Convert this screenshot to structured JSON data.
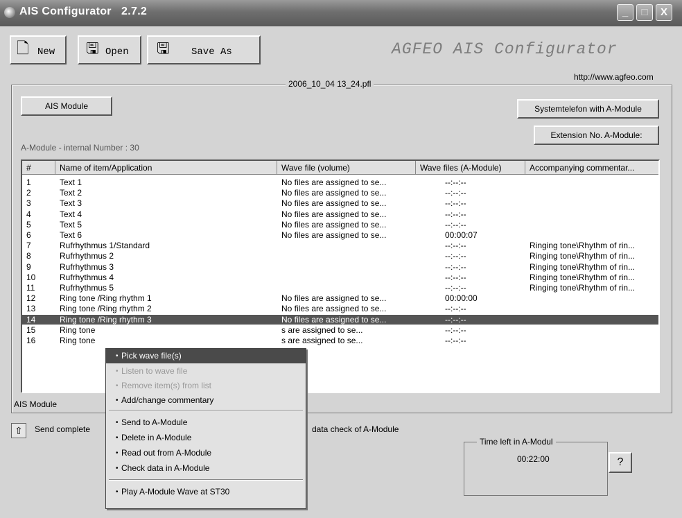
{
  "window": {
    "title": "AIS Configurator",
    "version": "2.7.2",
    "minimize": "_",
    "maximize": "□",
    "close": "X"
  },
  "toolbar": {
    "new_label": "New",
    "open_label": "Open",
    "saveas_label": "Save As",
    "new_icon": "new-document-icon",
    "open_icon": "floppy-disk-icon",
    "saveas_icon": "save-as-floppy-icon"
  },
  "brand": {
    "text": "AGFEO AIS Configurator",
    "url": "http://www.agfeo.com"
  },
  "group": {
    "title": "2006_10_04 13_24.pfl",
    "ais_module_button": "AIS Module",
    "systemtelefon_button": "Systemtelefon with A-Module",
    "extension_button": "Extension No. A-Module:",
    "internal_number_label": "A-Module - internal Number :  30"
  },
  "list": {
    "columns": [
      "#",
      "Name of item/Application",
      "Wave file (volume)",
      "Wave files (A-Module)",
      "Accompanying commentar..."
    ],
    "rows": [
      {
        "num": "1",
        "name": "Text 1",
        "wave": "No files are assigned to se...",
        "wave_a": "--:--:--",
        "comment": ""
      },
      {
        "num": "2",
        "name": "Text 2",
        "wave": "No files are assigned to se...",
        "wave_a": "--:--:--",
        "comment": ""
      },
      {
        "num": "3",
        "name": "Text 3",
        "wave": "No files are assigned to se...",
        "wave_a": "--:--:--",
        "comment": ""
      },
      {
        "num": "4",
        "name": "Text 4",
        "wave": "No files are assigned to se...",
        "wave_a": "--:--:--",
        "comment": ""
      },
      {
        "num": "5",
        "name": "Text 5",
        "wave": "No files are assigned to se...",
        "wave_a": "--:--:--",
        "comment": ""
      },
      {
        "num": "6",
        "name": "Text 6",
        "wave": "No files are assigned to se...",
        "wave_a": "00:00:07",
        "comment": ""
      },
      {
        "num": "7",
        "name": "Rufrhythmus 1/Standard",
        "wave": "",
        "wave_a": "--:--:--",
        "comment": "Ringing tone\\Rhythm of rin..."
      },
      {
        "num": "8",
        "name": "Rufrhythmus 2",
        "wave": "",
        "wave_a": "--:--:--",
        "comment": "Ringing tone\\Rhythm of rin..."
      },
      {
        "num": "9",
        "name": "Rufrhythmus 3",
        "wave": "",
        "wave_a": "--:--:--",
        "comment": "Ringing tone\\Rhythm of rin..."
      },
      {
        "num": "10",
        "name": "Rufrhythmus 4",
        "wave": "",
        "wave_a": "--:--:--",
        "comment": "Ringing tone\\Rhythm of rin..."
      },
      {
        "num": "11",
        "name": "Rufrhythmus 5",
        "wave": "",
        "wave_a": "--:--:--",
        "comment": "Ringing tone\\Rhythm of rin..."
      },
      {
        "num": "12",
        "name": "Ring tone /Ring rhythm 1",
        "wave": "No files are assigned to se...",
        "wave_a": "00:00:00",
        "comment": ""
      },
      {
        "num": "13",
        "name": "Ring tone /Ring rhythm 2",
        "wave": "No files are assigned to se...",
        "wave_a": "--:--:--",
        "comment": ""
      },
      {
        "num": "14",
        "name": "Ring tone /Ring rhythm 3",
        "wave": "No files are assigned to se...",
        "wave_a": "--:--:--",
        "comment": ""
      },
      {
        "num": "15",
        "name": "Ring tone",
        "wave": "s are assigned to se...",
        "wave_a": "--:--:--",
        "comment": ""
      },
      {
        "num": "16",
        "name": "Ring tone",
        "wave": "s are assigned to se...",
        "wave_a": "--:--:--",
        "comment": ""
      }
    ]
  },
  "status": {
    "label": "AIS Module"
  },
  "send": {
    "label_left": "Send complete",
    "label_right": "data check of A-Module",
    "icon": "send-upload-icon"
  },
  "time": {
    "label": "Time left in A-Modul",
    "value": "00:22:00",
    "help": "?"
  },
  "context_menu": {
    "items": [
      {
        "label": "Pick wave file(s)",
        "state": "highlight"
      },
      {
        "label": "Listen to wave file",
        "state": "disabled"
      },
      {
        "label": "Remove item(s) from list",
        "state": "disabled"
      },
      {
        "label": "Add/change commentary",
        "state": "normal"
      },
      {
        "label": "Send to A-Module",
        "state": "normal"
      },
      {
        "label": "Delete in A-Module",
        "state": "normal"
      },
      {
        "label": "Read out from A-Module",
        "state": "normal"
      },
      {
        "label": "Check data in A-Module",
        "state": "normal"
      },
      {
        "label": "Play A-Module Wave at ST30",
        "state": "normal"
      }
    ]
  }
}
